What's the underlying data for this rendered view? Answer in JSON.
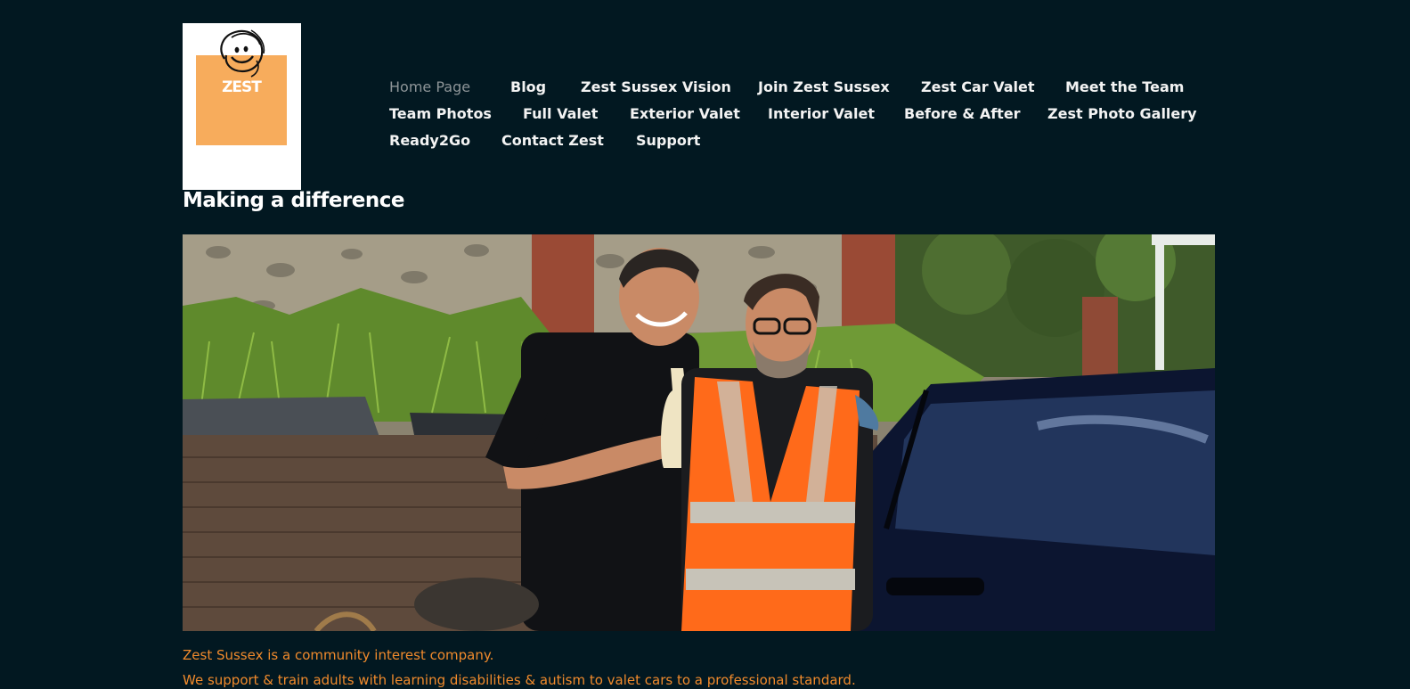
{
  "logo": {
    "text": "ZEST",
    "icon": "smiley-swirl-icon",
    "colors": {
      "square": "#f7ac5c",
      "background": "#ffffff"
    }
  },
  "nav": {
    "items": [
      {
        "label": "Home Page",
        "active": true
      },
      {
        "label": "Blog"
      },
      {
        "label": "Zest Sussex Vision"
      },
      {
        "label": "Join Zest Sussex"
      },
      {
        "label": "Zest Car Valet"
      },
      {
        "label": "Meet the Team"
      },
      {
        "label": "Team Photos"
      },
      {
        "label": "Full Valet"
      },
      {
        "label": "Exterior Valet"
      },
      {
        "label": "Interior Valet"
      },
      {
        "label": "Before & After"
      },
      {
        "label": "Zest Photo Gallery"
      },
      {
        "label": "Ready2Go"
      },
      {
        "label": "Contact Zest"
      },
      {
        "label": "Support"
      }
    ]
  },
  "page": {
    "title": "Making a difference"
  },
  "body": {
    "paragraphs": [
      "Zest Sussex is a community interest company.",
      "We support & train adults with learning disabilities & autism to valet cars to a professional standard."
    ]
  },
  "colors": {
    "background": "#021821",
    "nav_text": "#f3f3f3",
    "nav_active": "#8d9497",
    "body_text": "#f08a2c"
  }
}
